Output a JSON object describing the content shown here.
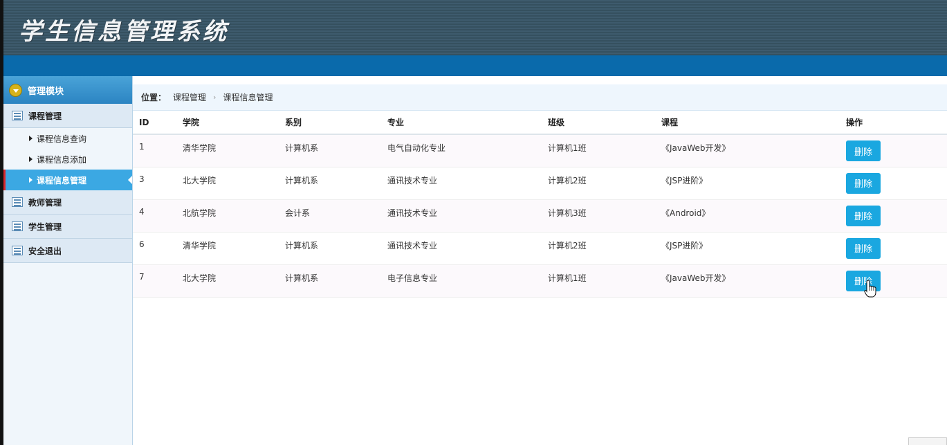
{
  "app": {
    "title": "学生信息管理系统"
  },
  "sidebar": {
    "module": "管理模块",
    "groups": [
      {
        "label": "课程管理",
        "items": [
          "课程信息查询",
          "课程信息添加",
          "课程信息管理"
        ],
        "active_item": "课程信息管理"
      },
      {
        "label": "教师管理"
      },
      {
        "label": "学生管理"
      },
      {
        "label": "安全退出"
      }
    ]
  },
  "breadcrumb": {
    "label": "位置：",
    "path": [
      "课程管理",
      "课程信息管理"
    ],
    "separator": "›"
  },
  "table": {
    "headers": [
      "ID",
      "学院",
      "系别",
      "专业",
      "班级",
      "课程",
      "操作"
    ],
    "rows": [
      [
        "1",
        "清华学院",
        "计算机系",
        "电气自动化专业",
        "计算机1班",
        "《JavaWeb开发》"
      ],
      [
        "3",
        "北大学院",
        "计算机系",
        "通讯技术专业",
        "计算机2班",
        "《JSP进阶》"
      ],
      [
        "4",
        "北航学院",
        "会计系",
        "通讯技术专业",
        "计算机3班",
        "《Android》"
      ],
      [
        "6",
        "清华学院",
        "计算机系",
        "通讯技术专业",
        "计算机2班",
        "《JSP进阶》"
      ],
      [
        "7",
        "北大学院",
        "计算机系",
        "电子信息专业",
        "计算机1班",
        "《JavaWeb开发》"
      ]
    ],
    "delete_label": "删除"
  },
  "colors": {
    "header_bg": "#3e5b6d",
    "blue_bar": "#0a6aab",
    "active_item": "#3ba8e3",
    "button": "#1aa7e0"
  }
}
